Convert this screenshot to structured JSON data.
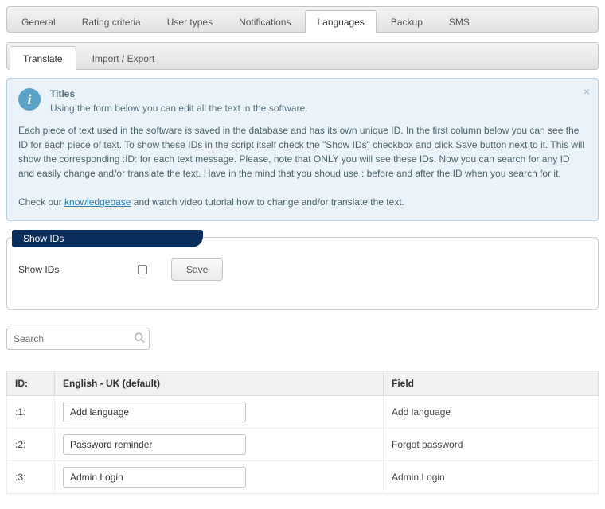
{
  "topTabs": [
    {
      "label": "General"
    },
    {
      "label": "Rating criteria"
    },
    {
      "label": "User types"
    },
    {
      "label": "Notifications"
    },
    {
      "label": "Languages",
      "active": true
    },
    {
      "label": "Backup"
    },
    {
      "label": "SMS"
    }
  ],
  "subTabs": [
    {
      "label": "Translate",
      "active": true
    },
    {
      "label": "Import / Export"
    }
  ],
  "info": {
    "title": "Titles",
    "subtitle": "Using the form below you can edit all the text in the software.",
    "body1": "Each piece of text used in the software is saved in the database and has its own unique ID. In the first column below you can see the ID for each piece of text. To show these IDs in the script itself check the \"Show IDs\" checkbox and click Save button next to it. This will show the corresponding :ID: for each text message. Please, note that ONLY you will see these IDs. Now you can search for any ID and easily change and/or translate the text. Have in the mind that you shoud use : before and after the ID when you search for it.",
    "body2_pre": "Check our ",
    "body2_link": "knowledgebase",
    "body2_post": " and watch video tutorial how to change and/or translate the text."
  },
  "fieldset": {
    "legend": "Show IDs",
    "label": "Show IDs",
    "saveLabel": "Save"
  },
  "search": {
    "placeholder": "Search"
  },
  "table": {
    "headers": {
      "id": "ID:",
      "lang": "English - UK (default)",
      "field": "Field"
    },
    "rows": [
      {
        "id": ":1:",
        "value": "Add language",
        "field": "Add language"
      },
      {
        "id": ":2:",
        "value": "Password reminder",
        "field": "Forgot password"
      },
      {
        "id": ":3:",
        "value": "Admin Login",
        "field": "Admin Login"
      }
    ]
  }
}
